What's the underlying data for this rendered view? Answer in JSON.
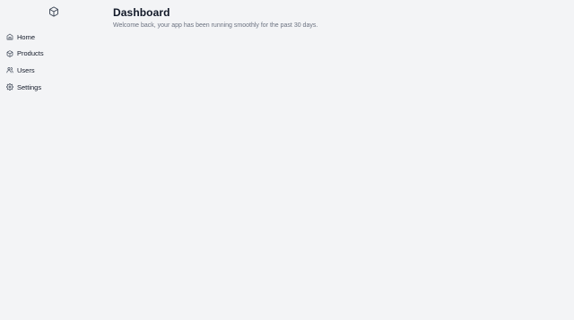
{
  "sidebar": {
    "logo_icon": "package-icon",
    "items": [
      {
        "label": "Home",
        "icon": "home-icon"
      },
      {
        "label": "Products",
        "icon": "package-icon"
      },
      {
        "label": "Users",
        "icon": "users-icon"
      },
      {
        "label": "Settings",
        "icon": "gear-icon"
      }
    ]
  },
  "main": {
    "title": "Dashboard",
    "subtitle": "Welcome back, your app has been running smoothly for the past 30 days."
  },
  "colors": {
    "background": "#f3f4f6",
    "text_primary": "#111827",
    "text_secondary": "#6b7280",
    "icon": "#374151"
  }
}
